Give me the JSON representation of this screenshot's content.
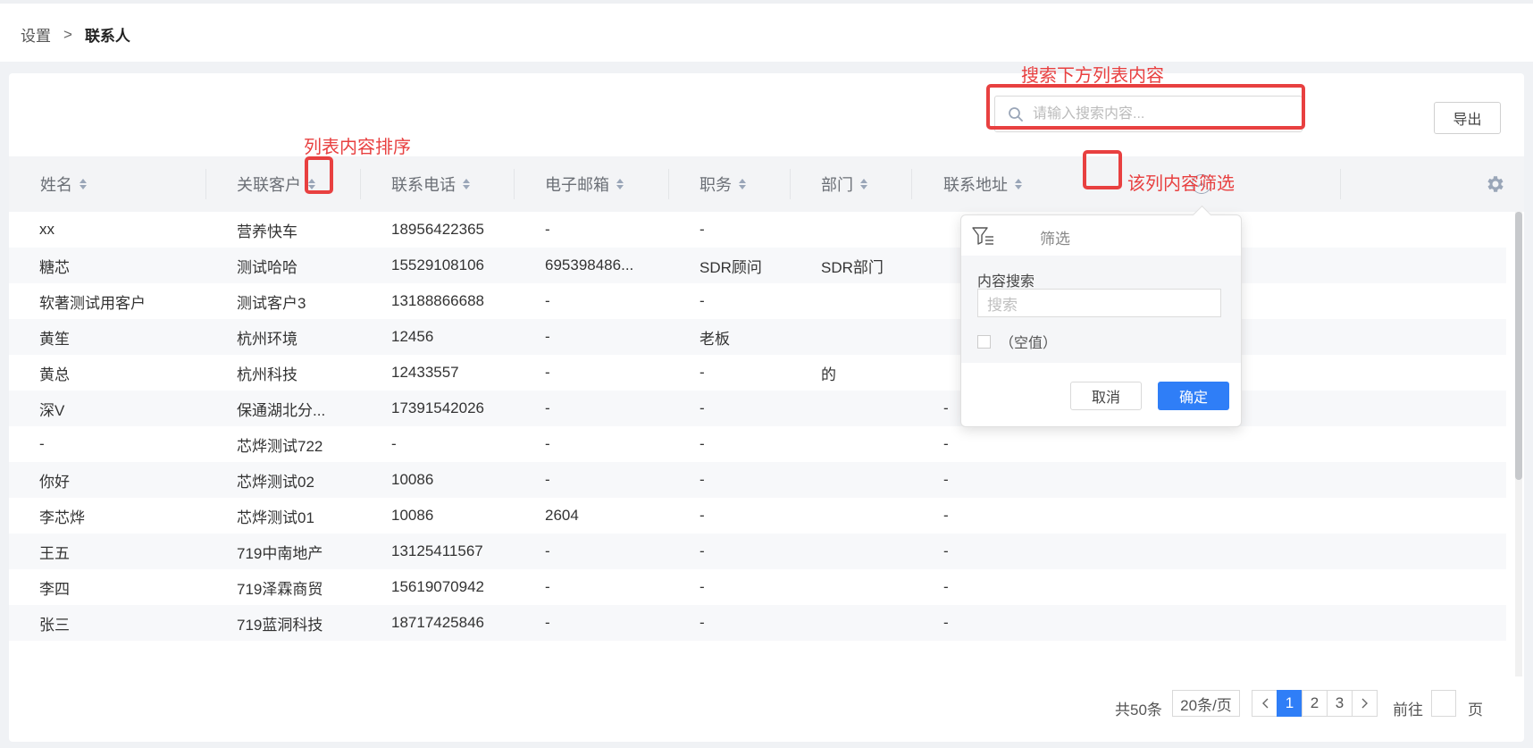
{
  "breadcrumb": {
    "parent": "设置",
    "separator": ">",
    "current": "联系人"
  },
  "toolbar": {
    "search_placeholder": "请输入搜索内容...",
    "export_label": "导出"
  },
  "table": {
    "columns": [
      "姓名",
      "关联客户",
      "联系电话",
      "电子邮箱",
      "职务",
      "部门",
      "联系地址"
    ],
    "rows": [
      [
        "xx",
        "营养快车",
        "18956422365",
        "-",
        "-",
        "",
        ""
      ],
      [
        "糖芯",
        "测试哈哈",
        "15529108106",
        "695398486...",
        "SDR顾问",
        "SDR部门",
        ""
      ],
      [
        "软著测试用客户",
        "测试客户3",
        "13188866688",
        "-",
        "-",
        "",
        ""
      ],
      [
        "黄笙",
        "杭州环境",
        "12456",
        "-",
        "老板",
        "",
        ""
      ],
      [
        "黄总",
        "杭州科技",
        "12433557",
        "-",
        "-",
        "的",
        ""
      ],
      [
        "深V",
        "保通湖北分...",
        "17391542026",
        "-",
        "-",
        "",
        "-"
      ],
      [
        "-",
        "芯烨测试722",
        "-",
        "-",
        "-",
        "",
        "-"
      ],
      [
        "你好",
        "芯烨测试02",
        "10086",
        "-",
        "-",
        "",
        "-"
      ],
      [
        "李芯烨",
        "芯烨测试01",
        "10086",
        "2604",
        "-",
        "",
        "-"
      ],
      [
        "王五",
        "719中南地产",
        "13125411567",
        "-",
        "-",
        "",
        "-"
      ],
      [
        "李四",
        "719泽霖商贸",
        "15619070942",
        "-",
        "-",
        "",
        "-"
      ],
      [
        "张三",
        "719蓝洞科技",
        "18717425846",
        "-",
        "-",
        "",
        "-"
      ]
    ]
  },
  "filter_popup": {
    "title": "筛选",
    "content_label": "内容搜索",
    "search_placeholder": "搜索",
    "empty_option": "（空值）",
    "cancel_label": "取消",
    "confirm_label": "确定"
  },
  "pagination": {
    "total": "共50条",
    "page_size": "20条/页",
    "pages": [
      "1",
      "2",
      "3"
    ],
    "current_page": "1",
    "goto_label": "前往",
    "page_label": "页"
  },
  "annotations": {
    "search": "搜索下方列表内容",
    "sort": "列表内容排序",
    "filter": "该列内容筛选"
  },
  "colors": {
    "accent": "#2f7ef7",
    "annotation": "#e84040"
  },
  "icons": {
    "search": "search-icon",
    "filter": "filter-icon",
    "settings": "gear-icon",
    "sort": "sort-icon",
    "dropdown": "chevron-up-circle-icon"
  }
}
